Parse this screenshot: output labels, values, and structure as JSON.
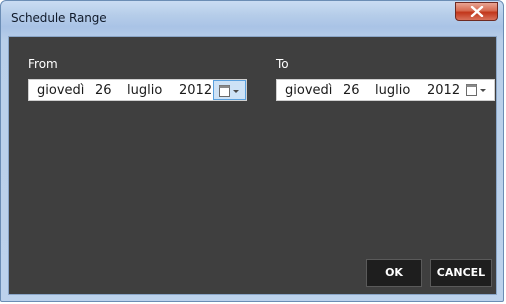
{
  "window": {
    "title": "Schedule Range"
  },
  "from": {
    "label": "From",
    "weekday": "giovedì",
    "day": "26",
    "month": "luglio",
    "year": "2012"
  },
  "to": {
    "label": "To",
    "weekday": "giovedì",
    "day": "26",
    "month": "luglio",
    "year": "2012"
  },
  "buttons": {
    "ok": "OK",
    "cancel": "CANCEL"
  },
  "icons": {
    "close": "close-icon",
    "calendar": "calendar-dropdown-icon"
  },
  "colors": {
    "client_background": "#3f3f3f",
    "close_button": "#c2361b",
    "calendar_button_active": "#cde2f6"
  }
}
